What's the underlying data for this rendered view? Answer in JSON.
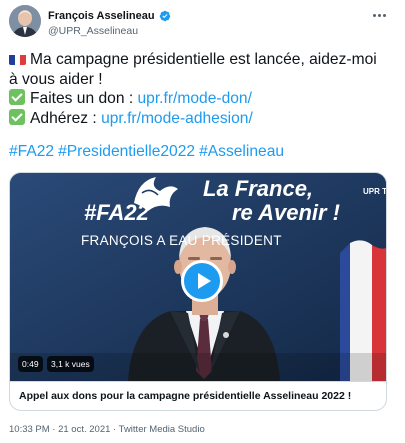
{
  "author": {
    "name": "François Asselineau",
    "handle": "@UPR_Asselineau",
    "verified": true
  },
  "tweet": {
    "line1": "Ma campagne présidentielle est lancée, aidez-moi",
    "line2": "à vous aider !",
    "don_label": "Faites un don : ",
    "don_link": "upr.fr/mode-don/",
    "adhesion_label": "Adhérez : ",
    "adhesion_link": "upr.fr/mode-adhesion/",
    "hashtags": [
      "#FA22",
      "#Presidentielle2022",
      "#Asselineau"
    ]
  },
  "video": {
    "slogan_line1": "La France,",
    "slogan_line2": "re Avenir !",
    "logo_text": "#FA22",
    "channel": "UPR TV",
    "subtitle": "FRANÇOIS A                EAU PRÉSIDENT",
    "duration": "0:49",
    "views": "3,1 k vues",
    "caption": "Appel aux dons pour la campagne présidentielle Asselineau 2022 !"
  },
  "meta": {
    "timestamp": "10:33 PM · 21 oct. 2021 · Twitter Media Studio"
  },
  "colors": {
    "link": "#1d9bf0",
    "verified": "#1d9bf0",
    "check_emoji": "#6ec15f",
    "video_bg": "#1e3a63"
  },
  "icons": {
    "more": "more-horizontal-icon",
    "verified": "verified-badge-icon",
    "play": "play-icon"
  }
}
